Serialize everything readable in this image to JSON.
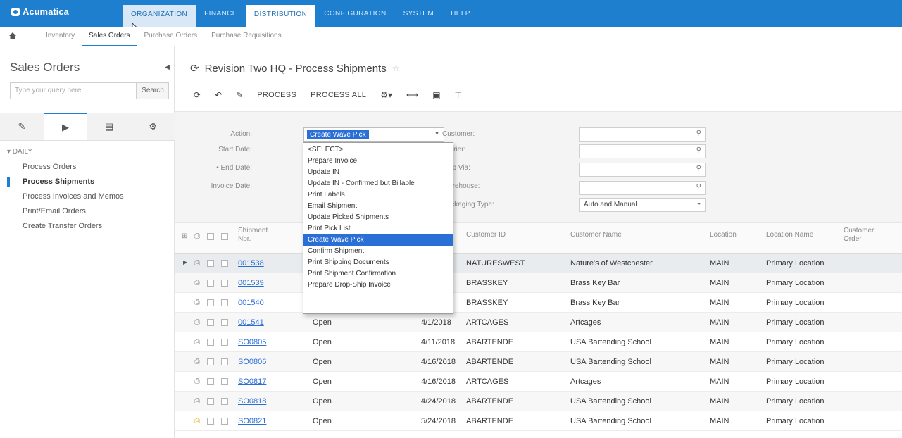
{
  "app": {
    "logo_text": "Acumatica"
  },
  "topnav": [
    {
      "label": "ORGANIZATION",
      "state": "hover"
    },
    {
      "label": "FINANCE",
      "state": ""
    },
    {
      "label": "DISTRIBUTION",
      "state": "active"
    },
    {
      "label": "CONFIGURATION",
      "state": ""
    },
    {
      "label": "SYSTEM",
      "state": ""
    },
    {
      "label": "HELP",
      "state": ""
    }
  ],
  "subnav": [
    {
      "label": "Inventory",
      "active": false
    },
    {
      "label": "Sales Orders",
      "active": true
    },
    {
      "label": "Purchase Orders",
      "active": false
    },
    {
      "label": "Purchase Requisitions",
      "active": false
    }
  ],
  "sidebar": {
    "title": "Sales Orders",
    "search_placeholder": "Type your query here",
    "search_button": "Search",
    "group": "DAILY",
    "items": [
      {
        "label": "Process Orders",
        "active": false
      },
      {
        "label": "Process Shipments",
        "active": true
      },
      {
        "label": "Process Invoices and Memos",
        "active": false
      },
      {
        "label": "Print/Email Orders",
        "active": false
      },
      {
        "label": "Create Transfer Orders",
        "active": false
      }
    ]
  },
  "page": {
    "title": "Revision Two HQ - Process Shipments",
    "toolbar": {
      "process": "PROCESS",
      "process_all": "PROCESS ALL"
    }
  },
  "filter": {
    "action_label": "Action:",
    "action_value": "Create Wave Pick",
    "start_date_label": "Start Date:",
    "end_date_label": "• End Date:",
    "invoice_date_label": "Invoice Date:",
    "customer_label": "Customer:",
    "carrier_label": "Carrier:",
    "ship_via_label": "Ship Via:",
    "warehouse_label": "Warehouse:",
    "packaging_label": "Packaging Type:",
    "packaging_value": "Auto and Manual"
  },
  "dropdown_options": [
    "<SELECT>",
    "Prepare Invoice",
    "Update IN",
    "Update IN - Confirmed but Billable",
    "Print Labels",
    "Email Shipment",
    "Update Picked Shipments",
    "Print Pick List",
    "Create Wave Pick",
    "Confirm Shipment",
    "Print Shipping Documents",
    "Print Shipment Confirmation",
    "Prepare Drop-Ship Invoice"
  ],
  "dropdown_selected_index": 8,
  "grid": {
    "headers": {
      "shipment_nbr": "Shipment Nbr.",
      "customer_id": "Customer ID",
      "customer_name": "Customer Name",
      "location": "Location",
      "location_name": "Location Name",
      "customer_order": "Customer Order"
    },
    "rows": [
      {
        "nbr": "001538",
        "status": "",
        "date": "4/1/2018",
        "cust_id": "NATURESWEST",
        "cust_name": "Nature's of Westchester",
        "location": "MAIN",
        "location_name": "Primary Location",
        "yellow": false
      },
      {
        "nbr": "001539",
        "status": "",
        "date": "4/1/2018",
        "cust_id": "BRASSKEY",
        "cust_name": "Brass Key Bar",
        "location": "MAIN",
        "location_name": "Primary Location",
        "yellow": false
      },
      {
        "nbr": "001540",
        "status": "",
        "date": "4/1/2018",
        "cust_id": "BRASSKEY",
        "cust_name": "Brass Key Bar",
        "location": "MAIN",
        "location_name": "Primary Location",
        "yellow": false
      },
      {
        "nbr": "001541",
        "status": "Open",
        "date": "4/1/2018",
        "cust_id": "ARTCAGES",
        "cust_name": "Artcages",
        "location": "MAIN",
        "location_name": "Primary Location",
        "yellow": false
      },
      {
        "nbr": "SO0805",
        "status": "Open",
        "date": "4/11/2018",
        "cust_id": "ABARTENDE",
        "cust_name": "USA Bartending School",
        "location": "MAIN",
        "location_name": "Primary Location",
        "yellow": false
      },
      {
        "nbr": "SO0806",
        "status": "Open",
        "date": "4/16/2018",
        "cust_id": "ABARTENDE",
        "cust_name": "USA Bartending School",
        "location": "MAIN",
        "location_name": "Primary Location",
        "yellow": false
      },
      {
        "nbr": "SO0817",
        "status": "Open",
        "date": "4/16/2018",
        "cust_id": "ARTCAGES",
        "cust_name": "Artcages",
        "location": "MAIN",
        "location_name": "Primary Location",
        "yellow": false
      },
      {
        "nbr": "SO0818",
        "status": "Open",
        "date": "4/24/2018",
        "cust_id": "ABARTENDE",
        "cust_name": "USA Bartending School",
        "location": "MAIN",
        "location_name": "Primary Location",
        "yellow": false
      },
      {
        "nbr": "SO0821",
        "status": "Open",
        "date": "5/24/2018",
        "cust_id": "ABARTENDE",
        "cust_name": "USA Bartending School",
        "location": "MAIN",
        "location_name": "Primary Location",
        "yellow": true
      }
    ]
  },
  "colors": {
    "accent": "#1f7fcf",
    "selection": "#2a6fd6",
    "link": "#2a6fd6"
  }
}
